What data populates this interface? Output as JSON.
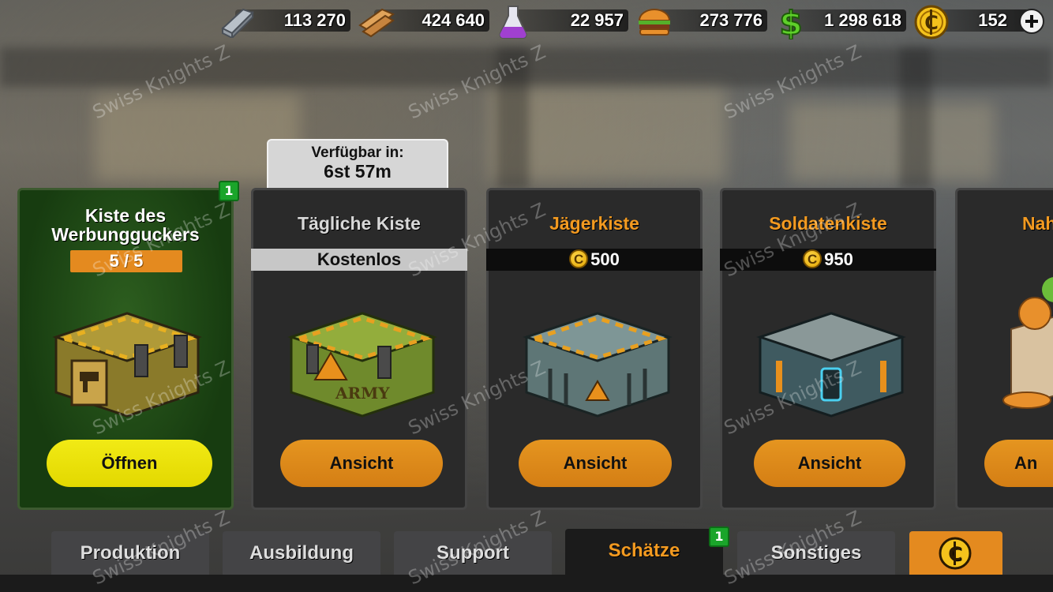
{
  "resources": [
    {
      "name": "iron",
      "icon": "iron-bar-icon",
      "value": "113 270"
    },
    {
      "name": "wood",
      "icon": "wood-planks-icon",
      "value": "424 640"
    },
    {
      "name": "chemicals",
      "icon": "flask-icon",
      "value": "22 957"
    },
    {
      "name": "food",
      "icon": "burger-icon",
      "value": "273 776"
    },
    {
      "name": "cash",
      "icon": "dollar-icon",
      "value": "1 298 618"
    },
    {
      "name": "coins",
      "icon": "coin-icon",
      "value": "152"
    }
  ],
  "timer": {
    "line1": "Verfügbar in:",
    "line2": "6st 57m"
  },
  "cards": [
    {
      "title": "Kiste des Werbungguckers",
      "progress": "5 / 5",
      "badge": "1",
      "button": "Öffnen"
    },
    {
      "title": "Tägliche Kiste",
      "price": "Kostenlos",
      "button": "Ansicht"
    },
    {
      "title": "Jägerkiste",
      "price": "500",
      "button": "Ansicht"
    },
    {
      "title": "Soldatenkiste",
      "price": "950",
      "button": "Ansicht"
    },
    {
      "title": "Nah",
      "button": "An"
    }
  ],
  "tabs": [
    {
      "label": "Produktion"
    },
    {
      "label": "Ausbildung"
    },
    {
      "label": "Support"
    },
    {
      "label": "Schätze",
      "badge": "1"
    },
    {
      "label": "Sonstiges"
    }
  ],
  "colors": {
    "accent": "#f39a20",
    "button_orange": "#e08a1a",
    "button_yellow": "#eee000",
    "badge_green": "#1aa52a"
  },
  "watermark": "Swiss Knights Z"
}
